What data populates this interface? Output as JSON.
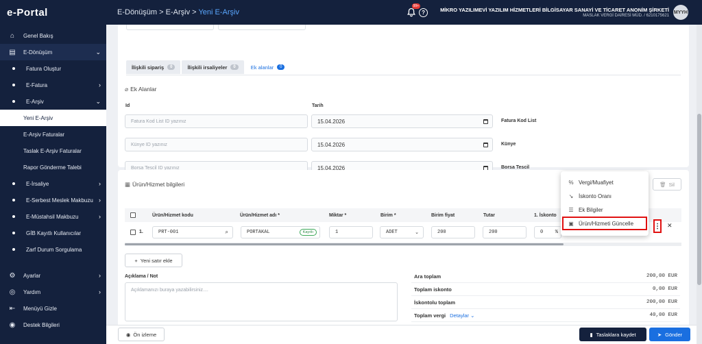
{
  "app": {
    "logo": "e-Portal"
  },
  "sidebar": {
    "items": [
      {
        "label": "Genel Bakış",
        "icon": "home-icon"
      },
      {
        "label": "E-Dönüşüm",
        "icon": "document-icon"
      },
      {
        "label": "Fatura Oluştur"
      },
      {
        "label": "E-Fatura"
      },
      {
        "label": "E-Arşiv"
      },
      {
        "label": "Yeni E-Arşiv"
      },
      {
        "label": "E-Arşiv Faturalar"
      },
      {
        "label": "Taslak E-Arşiv Faturalar"
      },
      {
        "label": "Rapor Gönderme Talebi"
      },
      {
        "label": "E-İrsaliye"
      },
      {
        "label": "E-Serbest Meslek Makbuzu"
      },
      {
        "label": "E-Müstahsil Makbuzu"
      },
      {
        "label": "GİB Kayıtlı Kullanıcılar"
      },
      {
        "label": "Zarf Durum Sorgulama"
      },
      {
        "label": "Ayarlar",
        "icon": "gear-icon"
      },
      {
        "label": "Yardım",
        "icon": "help-icon"
      },
      {
        "label": "Menüyü Gizle",
        "icon": "collapse-icon"
      },
      {
        "label": "Destek Bilgileri",
        "icon": "support-icon"
      }
    ]
  },
  "header": {
    "breadcrumb": [
      "E-Dönüşüm",
      "E-Arşiv",
      "Yeni E-Arşiv"
    ],
    "sep": ">",
    "notification_count": "99+",
    "company_name": "MİKRO YAZILIMEVİ YAZILIM HİZMETLERİ BİLGİSAYAR SANAYİ VE TİCARET ANONİM ŞİRKETİ",
    "tax_info": "MASLAK VERGİ DAİRESİ MÜD. / 6210175621",
    "avatar": "MYYH"
  },
  "tabs": [
    {
      "label": "İlişkili sipariş",
      "count": "0"
    },
    {
      "label": "İlişkili irsaliyeler",
      "count": "0"
    },
    {
      "label": "Ek alanlar",
      "count": "0"
    }
  ],
  "ek_alanlar": {
    "title": "Ek Alanlar",
    "col_id": "Id",
    "col_date": "Tarih",
    "rows": [
      {
        "placeholder": "Fatura Kod List ID yazınız",
        "date": "15.04.2026",
        "label": "Fatura Kod List"
      },
      {
        "placeholder": "Künye ID yazınız",
        "date": "15.04.2026",
        "label": "Künye"
      },
      {
        "placeholder": "Borsa Tescil  ID yazınız",
        "date": "15.04.2026",
        "label": "Borsa Tescil"
      }
    ]
  },
  "products": {
    "title": "Ürün/Hizmet bilgileri",
    "delete_label": "Sil",
    "columns": [
      "Ürün/Hizmet kodu",
      "Ürün/Hizmet adı *",
      "Miktar *",
      "Birim *",
      "Birim fiyat",
      "Tutar",
      "1. İskonto"
    ],
    "row": {
      "index": "1.",
      "code": "PRT-001",
      "name": "PORTAKAL",
      "status": "Kayıtlı",
      "qty": "1",
      "unit": "ADET",
      "price": "200",
      "total": "200",
      "discount": "0",
      "discount_unit": "%"
    },
    "add_row": "Yeni satır ekle"
  },
  "menu": {
    "items": [
      {
        "label": "Vergi/Muafiyet",
        "icon": "percent-icon"
      },
      {
        "label": "İskonto Oranı",
        "icon": "trend-down-icon"
      },
      {
        "label": "Ek Bilgiler",
        "icon": "list-icon"
      },
      {
        "label": "Ürün/Hizmeti Güncelle",
        "icon": "save-icon"
      }
    ]
  },
  "note": {
    "label": "Açıklama / Not",
    "placeholder": "Açıklamanızı buraya yazabilirsiniz...."
  },
  "totals": [
    {
      "label": "Ara toplam",
      "value": "200,00 EUR"
    },
    {
      "label": "Toplam iskonto",
      "value": "0,00 EUR"
    },
    {
      "label": "İskontolu toplam",
      "value": "200,00 EUR"
    },
    {
      "label": "Toplam vergi",
      "value": "40,00 EUR",
      "extra": "Detaylar"
    }
  ],
  "footer": {
    "preview": "Ön izleme",
    "save_draft": "Taslaklara kaydet",
    "send": "Gönder"
  }
}
